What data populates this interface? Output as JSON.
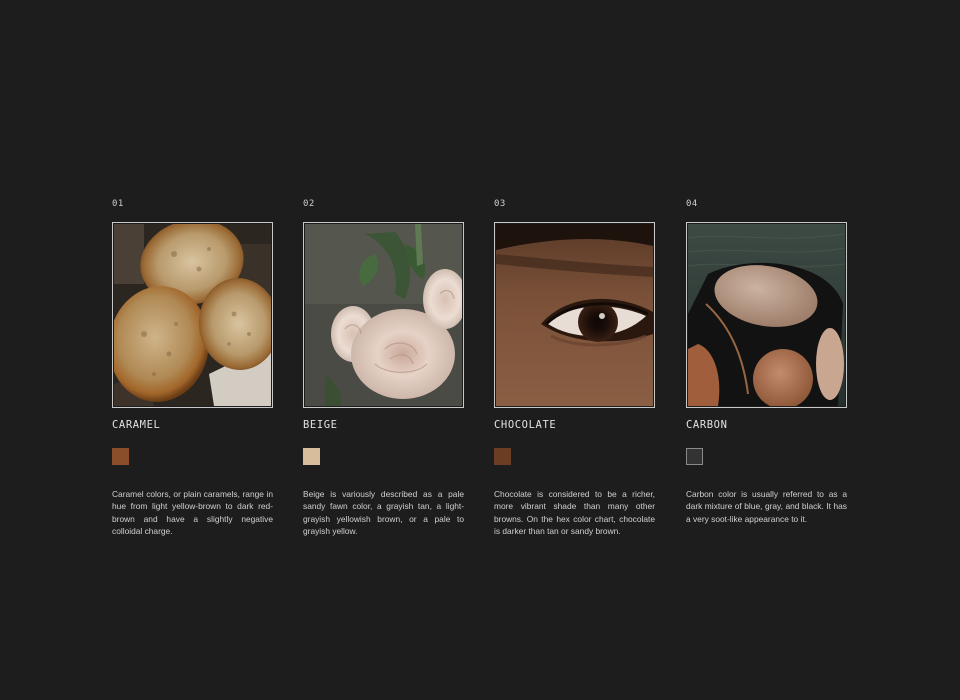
{
  "palette": [
    {
      "number": "01",
      "name": "CARAMEL",
      "swatch_color": "#8a4f2a",
      "description": "Caramel colors, or plain caramels, range in hue from light yellow-brown to dark red-brown and have a slightly negative colloidal charge.",
      "image_icon": "bread-slices-photo"
    },
    {
      "number": "02",
      "name": "BEIGE",
      "swatch_color": "#d7bd9c",
      "description": "Beige is variously described as a pale sandy fawn color, a grayish tan, a light-grayish yellowish brown, or a pale to grayish yellow.",
      "image_icon": "white-roses-photo"
    },
    {
      "number": "03",
      "name": "CHOCOLATE",
      "swatch_color": "#6b3d22",
      "description": "Chocolate is considered to be a richer, more vibrant shade than many other browns. On the hex color chart, chocolate is darker than tan or sandy brown.",
      "image_icon": "eye-closeup-photo"
    },
    {
      "number": "04",
      "name": "CARBON",
      "swatch_color": "#333333",
      "description": "Carbon color is usually referred to as a dark mixture of blue, gray, and black. It has a very soot-like appearance to it.",
      "image_icon": "water-abstract-photo"
    }
  ]
}
